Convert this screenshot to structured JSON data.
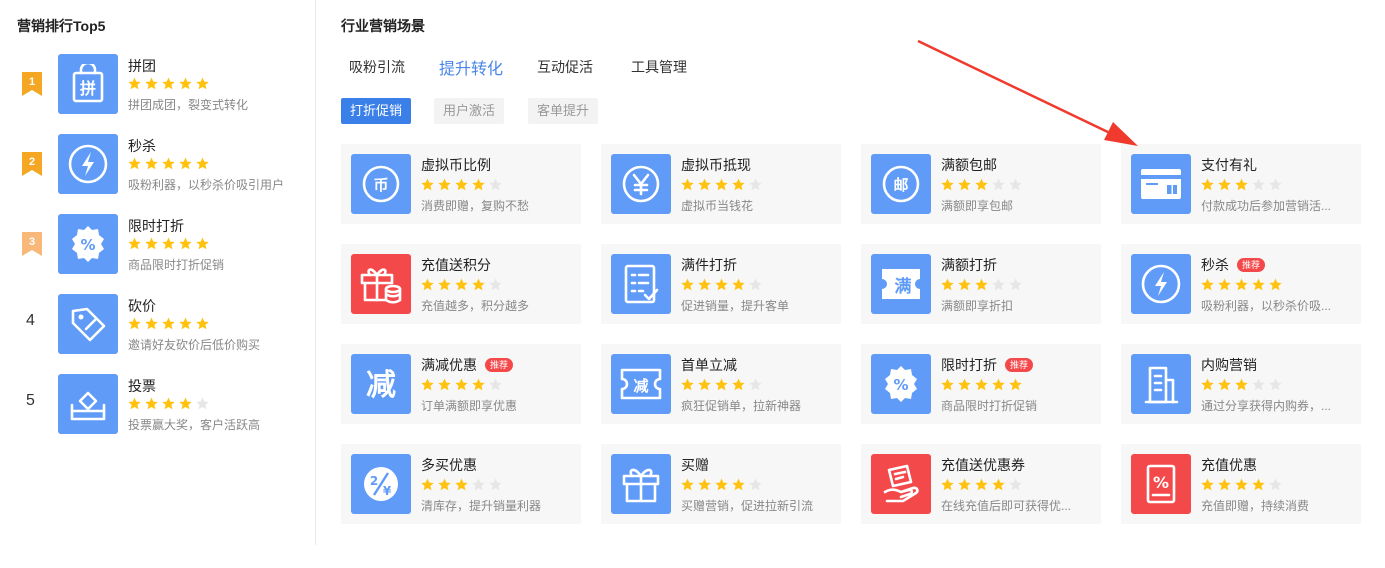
{
  "left": {
    "title": "营销排行Top5",
    "items": [
      {
        "rank": "1",
        "name": "拼团",
        "stars": 5,
        "desc": "拼团成团，裂变式转化",
        "icon": "group-buy-bag-icon",
        "badge_color": "#f5a623"
      },
      {
        "rank": "2",
        "name": "秒杀",
        "stars": 5,
        "desc": "吸粉利器，以秒杀价吸引用户",
        "icon": "lightning-icon",
        "badge_color": "#f5a623"
      },
      {
        "rank": "3",
        "name": "限时打折",
        "stars": 5,
        "desc": "商品限时打折促销",
        "icon": "percent-badge-icon",
        "badge_color": "#f7b87a"
      },
      {
        "rank": "4",
        "name": "砍价",
        "stars": 5,
        "desc": "邀请好友砍价后低价购买",
        "icon": "price-tag-icon"
      },
      {
        "rank": "5",
        "name": "投票",
        "stars": 4,
        "desc": "投票赢大奖，客户活跃高",
        "icon": "ballot-box-icon"
      }
    ]
  },
  "right": {
    "title": "行业营销场景",
    "tabs": [
      "吸粉引流",
      "提升转化",
      "互动促活",
      "工具管理"
    ],
    "active_tab": 1,
    "subtabs": [
      "打折促销",
      "用户激活",
      "客单提升"
    ],
    "active_subtab": 0,
    "cards": [
      {
        "name": "虚拟币比例",
        "stars": 4,
        "desc": "消费即赠，复购不愁",
        "icon": "coin-icon",
        "tag": ""
      },
      {
        "name": "虚拟币抵现",
        "stars": 4,
        "desc": "虚拟币当钱花",
        "icon": "yen-coin-icon",
        "tag": ""
      },
      {
        "name": "满额包邮",
        "stars": 3,
        "desc": "满额即享包邮",
        "icon": "post-icon",
        "tag": ""
      },
      {
        "name": "支付有礼",
        "stars": 3,
        "desc": "付款成功后参加营销活...",
        "icon": "payment-gift-card-icon",
        "tag": ""
      },
      {
        "name": "充值送积分",
        "stars": 4,
        "desc": "充值越多，积分越多",
        "icon": "gift-coins-icon",
        "tag": "",
        "red": true
      },
      {
        "name": "满件打折",
        "stars": 4,
        "desc": "促进销量，提升客单",
        "icon": "checklist-icon",
        "tag": ""
      },
      {
        "name": "满额打折",
        "stars": 3,
        "desc": "满额即享折扣",
        "icon": "full-ticket-icon",
        "tag": ""
      },
      {
        "name": "秒杀",
        "stars": 5,
        "desc": "吸粉利器，以秒杀价吸...",
        "icon": "lightning-icon",
        "tag": "推荐"
      },
      {
        "name": "满减优惠",
        "stars": 4,
        "desc": "订单满额即享优惠",
        "icon": "reduce-icon",
        "tag": "推荐"
      },
      {
        "name": "首单立减",
        "stars": 4,
        "desc": "疯狂促销单，拉新神器",
        "icon": "reduce-ticket-icon",
        "tag": ""
      },
      {
        "name": "限时打折",
        "stars": 5,
        "desc": "商品限时打折促销",
        "icon": "percent-badge-icon",
        "tag": "推荐"
      },
      {
        "name": "内购营销",
        "stars": 3,
        "desc": "通过分享获得内购券，...",
        "icon": "building-icon",
        "tag": ""
      },
      {
        "name": "多买优惠",
        "stars": 3,
        "desc": "清库存，提升销量利器",
        "icon": "discount-yen-icon",
        "tag": ""
      },
      {
        "name": "买赠",
        "stars": 4,
        "desc": "买赠营销，促进拉新引流",
        "icon": "gift-box-icon",
        "tag": ""
      },
      {
        "name": "充值送优惠券",
        "stars": 4,
        "desc": "在线充值后即可获得优...",
        "icon": "coupon-hand-icon",
        "tag": "",
        "red": true
      },
      {
        "name": "充值优惠",
        "stars": 4,
        "desc": "充值即赠，持续消费",
        "icon": "percent-ticket-icon",
        "tag": "",
        "red": true
      }
    ]
  },
  "colors": {
    "accent": "#3b7fe8",
    "icon_blue": "#5f9bf7",
    "icon_red": "#f4494b",
    "star": "#ffc20e",
    "arrow": "#f03a2e"
  }
}
